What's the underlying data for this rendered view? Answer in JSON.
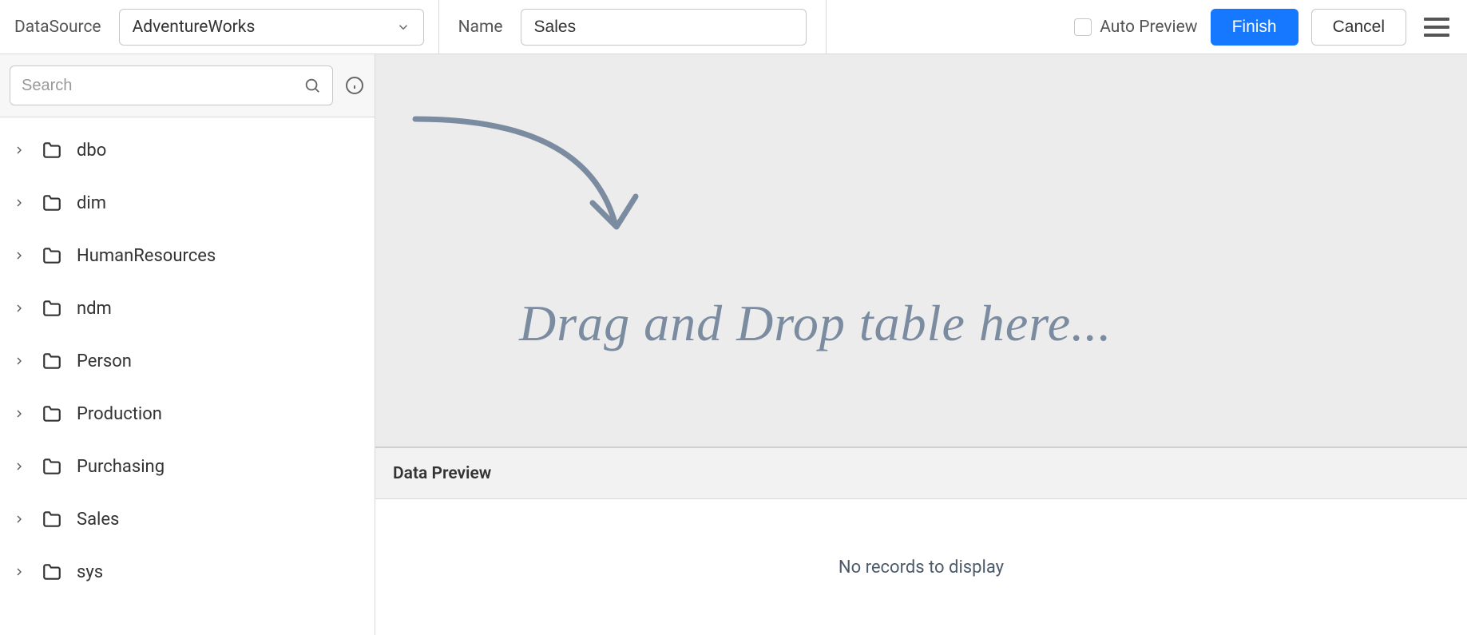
{
  "toolbar": {
    "datasource_label": "DataSource",
    "datasource_value": "AdventureWorks",
    "name_label": "Name",
    "name_value": "Sales",
    "auto_preview_label": "Auto Preview",
    "finish_label": "Finish",
    "cancel_label": "Cancel"
  },
  "sidebar": {
    "search_placeholder": "Search",
    "items": [
      {
        "label": "dbo"
      },
      {
        "label": "dim"
      },
      {
        "label": "HumanResources"
      },
      {
        "label": "ndm"
      },
      {
        "label": "Person"
      },
      {
        "label": "Production"
      },
      {
        "label": "Purchasing"
      },
      {
        "label": "Sales"
      },
      {
        "label": "sys"
      }
    ]
  },
  "main": {
    "drop_hint": "Drag and Drop table here...",
    "preview_header": "Data Preview",
    "preview_empty": "No records to display"
  }
}
